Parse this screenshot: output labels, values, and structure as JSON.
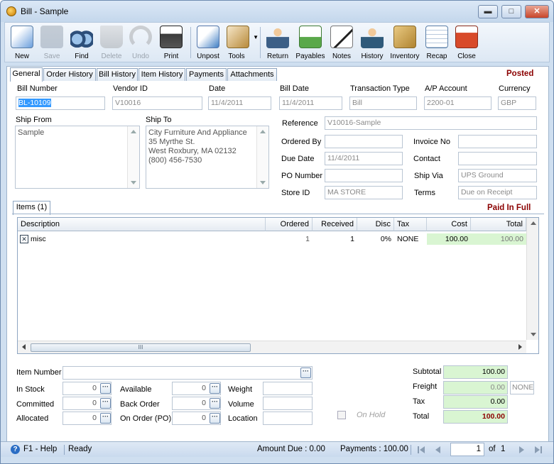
{
  "window": {
    "title": "Bill - Sample",
    "min_label": "▭",
    "max_label": "◻",
    "close_label": "✕"
  },
  "toolbar": [
    {
      "label": "New",
      "icon": "new-document-icon",
      "enabled": true
    },
    {
      "label": "Save",
      "icon": "floppy-disk-icon",
      "enabled": false
    },
    {
      "label": "Find",
      "icon": "binoculars-icon",
      "enabled": true
    },
    {
      "label": "Delete",
      "icon": "trash-bin-icon",
      "enabled": false
    },
    {
      "label": "Undo",
      "icon": "undo-arrow-icon",
      "enabled": false
    },
    {
      "label": "Print",
      "icon": "printer-icon",
      "enabled": true
    },
    {
      "label": "Unpost",
      "icon": "unpost-icon",
      "enabled": true
    },
    {
      "label": "Tools",
      "icon": "tools-icon",
      "enabled": true
    },
    {
      "label": "Return",
      "icon": "return-person-icon",
      "enabled": true
    },
    {
      "label": "Payables",
      "icon": "payables-money-icon",
      "enabled": true
    },
    {
      "label": "Notes",
      "icon": "notes-pen-icon",
      "enabled": true
    },
    {
      "label": "History",
      "icon": "history-person-icon",
      "enabled": true
    },
    {
      "label": "Inventory",
      "icon": "inventory-boxes-icon",
      "enabled": true
    },
    {
      "label": "Recap",
      "icon": "recap-sheet-icon",
      "enabled": true
    },
    {
      "label": "Close",
      "icon": "close-window-icon",
      "enabled": true
    }
  ],
  "tabs": [
    "General",
    "Order History",
    "Bill History",
    "Item History",
    "Payments",
    "Attachments"
  ],
  "status": "Posted",
  "header": {
    "bill_number_label": "Bill Number",
    "bill_number": "BL-10109",
    "vendor_id_label": "Vendor ID",
    "vendor_id": "V10016",
    "date_label": "Date",
    "date": "11/4/2011",
    "bill_date_label": "Bill Date",
    "bill_date": "11/4/2011",
    "transaction_type_label": "Transaction Type",
    "transaction_type": "Bill",
    "ap_account_label": "A/P Account",
    "ap_account": "2200-01",
    "currency_label": "Currency",
    "currency": "GBP"
  },
  "ship_from": {
    "label": "Ship From",
    "value": "Sample"
  },
  "ship_to": {
    "label": "Ship To",
    "lines": [
      "City Furniture And Appliance",
      "35 Myrthe St.",
      "West Roxbury, MA 02132",
      "(800) 456-7530"
    ]
  },
  "details": {
    "reference_label": "Reference",
    "reference": "V10016-Sample",
    "ordered_by_label": "Ordered By",
    "ordered_by": "",
    "invoice_no_label": "Invoice No",
    "invoice_no": "",
    "due_date_label": "Due Date",
    "due_date": "11/4/2011",
    "contact_label": "Contact",
    "contact": "",
    "po_number_label": "PO Number",
    "po_number": "",
    "ship_via_label": "Ship Via",
    "ship_via": "UPS Ground",
    "store_id_label": "Store ID",
    "store_id": "MA STORE",
    "terms_label": "Terms",
    "terms": "Due on Receipt"
  },
  "items": {
    "tab_label": "Items (1)",
    "status": "Paid In Full",
    "columns": [
      "Description",
      "Ordered",
      "Received",
      "Disc",
      "Tax",
      "Cost",
      "Total"
    ],
    "rows": [
      {
        "checkbox": "✕",
        "description": "misc",
        "ordered": "1",
        "received": "1",
        "disc": "0%",
        "tax": "NONE",
        "cost": "100.00",
        "total": "100.00"
      }
    ],
    "scroll_thumb": "III"
  },
  "item_info": {
    "item_number_label": "Item Number",
    "item_number": "",
    "in_stock_label": "In Stock",
    "in_stock": "0",
    "available_label": "Available",
    "available": "0",
    "weight_label": "Weight",
    "weight": "",
    "committed_label": "Committed",
    "committed": "0",
    "back_order_label": "Back Order",
    "back_order": "0",
    "volume_label": "Volume",
    "volume": "",
    "allocated_label": "Allocated",
    "allocated": "0",
    "on_order_label": "On Order (PO)",
    "on_order": "0",
    "location_label": "Location",
    "location": "",
    "on_hold_label": "On Hold",
    "dots": "···"
  },
  "totals": {
    "subtotal_label": "Subtotal",
    "subtotal": "100.00",
    "freight_label": "Freight",
    "freight": "0.00",
    "freight_tax": "NONE",
    "tax_label": "Tax",
    "tax": "0.00",
    "total_label": "Total",
    "total": "100.00"
  },
  "statusbar": {
    "help": "F1 - Help",
    "ready": "Ready",
    "amount_due": "Amount Due : 0.00",
    "payments": "Payments : 100.00",
    "page": "1",
    "of": "of",
    "pages": "1"
  },
  "colors": {
    "posted": "#8b0000",
    "cost_highlight": "#d9f5d2",
    "total_highlight": "#c6f0bc"
  }
}
